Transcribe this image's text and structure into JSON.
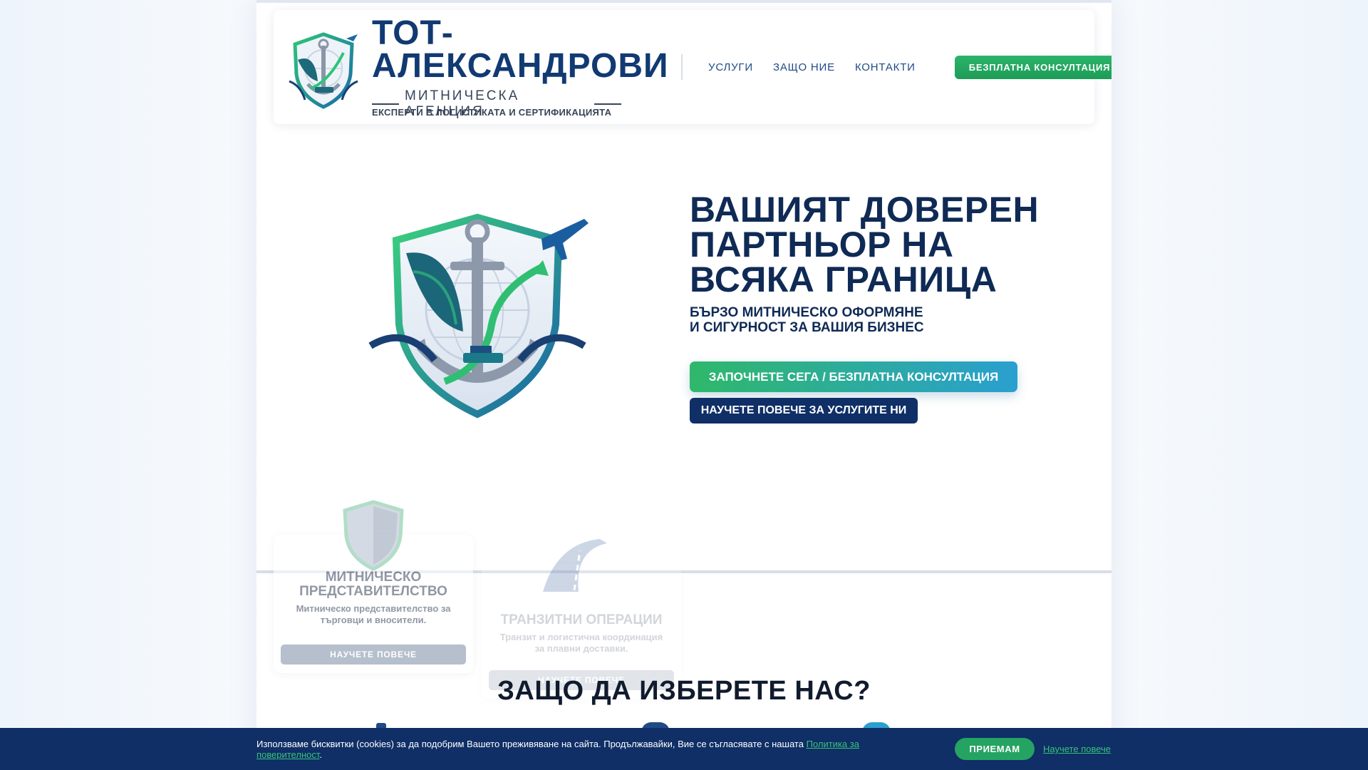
{
  "brand": {
    "title": "ТОТ-АЛЕКСАНДРОВИ",
    "subtitle": "МИТНИЧЕСКА АГЕНЦИЯ",
    "tagline": "ЕКСПЕРТИ В ЛОГИСТИКАТА И СЕРТИФИКАЦИЯТА"
  },
  "nav": {
    "items": [
      "УСЛУГИ",
      "ЗАЩО НИЕ",
      "КОНТАКТИ"
    ],
    "cta": "БЕЗПЛАТНА КОНСУЛТАЦИЯ"
  },
  "hero": {
    "heading": "ВАШИЯТ ДОВЕРЕН ПАРТНЬОР НА ВСЯКА ГРАНИЦА",
    "subheading": "БЪРЗО МИТНИЧЕСКО ОФОРМЯНЕ И СИГУРНОСТ ЗА ВАШИЯ БИЗНЕС",
    "primary_button": "ЗАПОЧНЕТЕ СЕГА / БЕЗПЛАТНА КОНСУЛТАЦИЯ",
    "secondary_button": "НАУЧЕТЕ ПОВЕЧЕ ЗА УСЛУГИТЕ НИ"
  },
  "services": [
    {
      "title": "МИТНИЧЕСКО ПРЕДСТАВИТЕЛСТВО",
      "description": "Митническо представителство за търговци и вносители.",
      "button": "НАУЧЕТЕ ПОВЕЧЕ",
      "icon": "shield-icon"
    },
    {
      "title": "ТРАНЗИТНИ ОПЕРАЦИИ",
      "description": "Транзит и логистична координация за плавни доставки.",
      "button": "НАУЧЕТЕ ПОВЕЧЕ",
      "icon": "road-icon"
    }
  ],
  "why_section": {
    "heading": "ЗАЩО ДА ИЗБЕРЕТЕ НАС?"
  },
  "cookie": {
    "text": "Използваме бисквитки (cookies) за да подобрим Вашето преживяване на сайта. Продължавайки, Вие се съгласявате с нашата",
    "policy_link": "Политика за поверителност",
    "end": ".",
    "accept": "ПРИЕМАМ",
    "learn_more": "Научете повече"
  },
  "colors": {
    "navy": "#0f2f66",
    "brand_blue": "#123a72",
    "green": "#2bb46a",
    "teal": "#2a9fd0"
  }
}
